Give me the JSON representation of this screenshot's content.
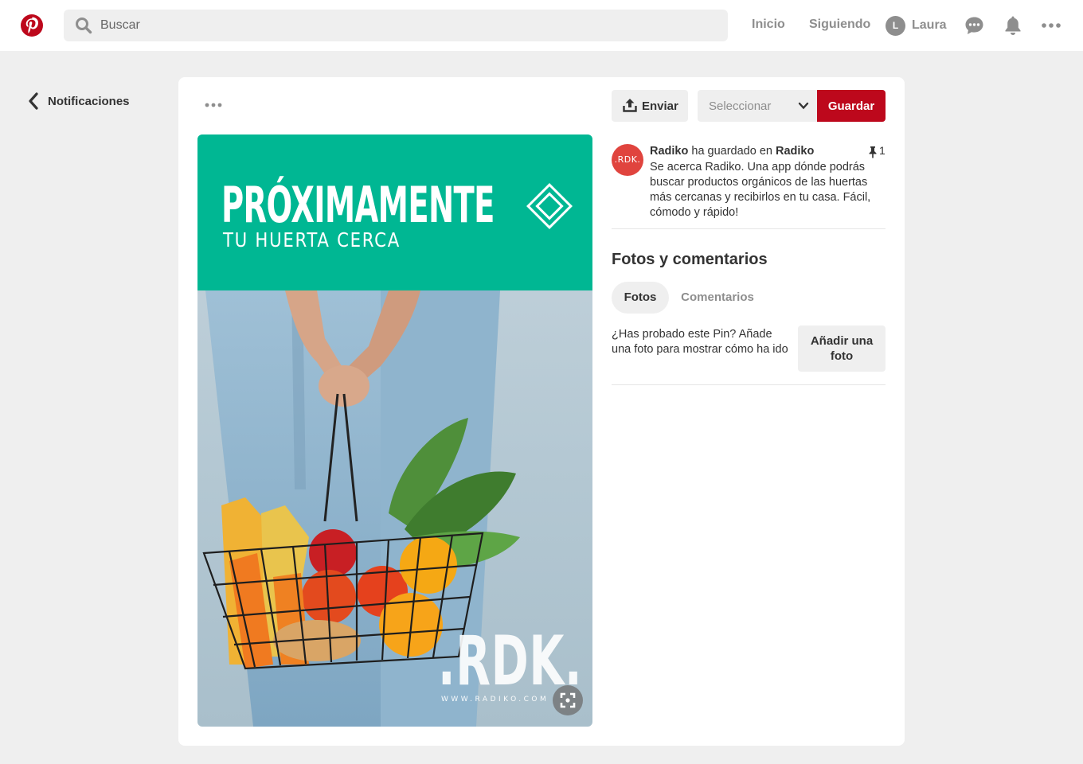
{
  "header": {
    "logo_icon": "pinterest-logo",
    "search_placeholder": "Buscar",
    "nav": {
      "home": "Inicio",
      "following": "Siguiendo"
    },
    "user": {
      "initial": "L",
      "name": "Laura"
    },
    "icons": [
      "messages-icon",
      "notifications-bell-icon",
      "more-options-icon"
    ]
  },
  "sidebar": {
    "back_label": "Notificaciones"
  },
  "pin": {
    "image": {
      "headline": "PRÓXIMAMENTE",
      "subheadline": "TU HUERTA CERCA",
      "brand": ".RDK.",
      "url_text": "WWW.RADIKO.COM"
    },
    "actions": {
      "send_label": "Enviar",
      "board_select_placeholder": "Seleccionar",
      "save_label": "Guardar"
    },
    "saver": {
      "avatar_text": ".RDK.",
      "user": "Radiko",
      "action_text": "ha guardado en",
      "board": "Radiko",
      "description": "Se acerca Radiko. Una app dónde podrás buscar productos orgánicos de las huertas más cercanas y recibirlos en tu casa. Fácil, cómodo y rápido!",
      "pin_count": "1"
    },
    "photos_comments": {
      "title": "Fotos y comentarios",
      "tabs": [
        "Fotos",
        "Comentarios"
      ],
      "active_tab": "Fotos",
      "prompt": "¿Has probado este Pin? Añade una foto para mostrar cómo ha ido",
      "add_photo_label": "Añadir una foto"
    }
  },
  "colors": {
    "brand_red": "#bd081c",
    "banner_green": "#00b793",
    "avatar_red": "#e0443e",
    "page_bg": "#efefef"
  }
}
